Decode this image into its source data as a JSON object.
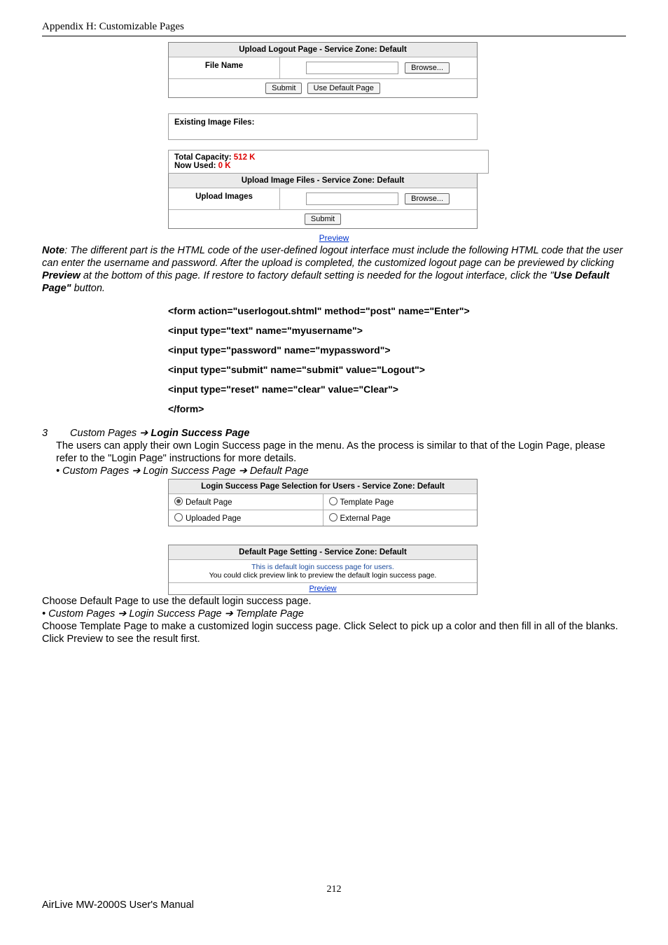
{
  "header": {
    "text": "Appendix H:    Customizable Pages"
  },
  "uploadLogout": {
    "title": "Upload Logout Page - Service Zone: Default",
    "fileNameLabel": "File Name",
    "browse": "Browse...",
    "submit": "Submit",
    "useDefault": "Use Default Page"
  },
  "existing": {
    "label": "Existing Image Files:"
  },
  "capacity": {
    "l1a": "Total Capacity:",
    "l1b": "512 K",
    "l2a": "Now Used:",
    "l2b": "0 K"
  },
  "uploadImages": {
    "title": "Upload Image Files - Service Zone: Default",
    "label": "Upload Images",
    "browse": "Browse...",
    "submit": "Submit"
  },
  "previewLink": "Preview",
  "note": {
    "boldNote": "Note",
    "p1": ": The different part is the HTML code of the user-defined logout interface must include the following HTML code that the user can enter the username and password. After the upload is completed, the customized logout page can be previewed by clicking ",
    "boldPreview": "Preview",
    "p2": " at the bottom of this page. If restore to factory default setting is needed for the logout interface, click the \"",
    "boldUseDefault": "Use Default Page\"",
    "p3": " button."
  },
  "code": {
    "l1": "<form action=\"userlogout.shtml\" method=\"post\" name=\"Enter\">",
    "l2": "<input type=\"text\" name=\"myusername\">",
    "l3": "<input type=\"password\" name=\"mypassword\">",
    "l4": "<input type=\"submit\" name=\"submit\" value=\"Logout\">",
    "l5": "<input type=\"reset\" name=\"clear\" value=\"Clear\">",
    "l6": "</form>"
  },
  "sec3": {
    "num": "3",
    "hdr1": "Custom Pages",
    "arrow": "➔",
    "hdr2": "Login Success Page",
    "body": "The users can apply their own Login Success page in the menu. As the process is similar to that of the Login Page, please refer to the \"Login Page\" instructions for more details.",
    "bullet1": "• Custom Pages ➔ Login Success Page ➔ Default Page"
  },
  "radioTbl": {
    "title": "Login Success Page Selection for Users - Service Zone: Default",
    "r1c1": "Default Page",
    "r1c2": "Template Page",
    "r2c1": "Uploaded Page",
    "r2c2": "External Page"
  },
  "defSet": {
    "title": "Default Page Setting - Service Zone: Default",
    "line1": "This is default login success page for users.",
    "line2": "You could click preview link to preview the default login success page.",
    "preview": "Preview"
  },
  "after": {
    "l1": "Choose Default Page to use the default login success page.",
    "l2": "•     Custom Pages ➔ Login Success Page ➔ Template Page",
    "l3": "Choose Template Page to make a customized login success page. Click Select to pick up a color and then fill in all of the blanks. Click Preview to see the result first."
  },
  "footer": {
    "pageNo": "212",
    "text": "AirLive MW-2000S User's Manual"
  }
}
